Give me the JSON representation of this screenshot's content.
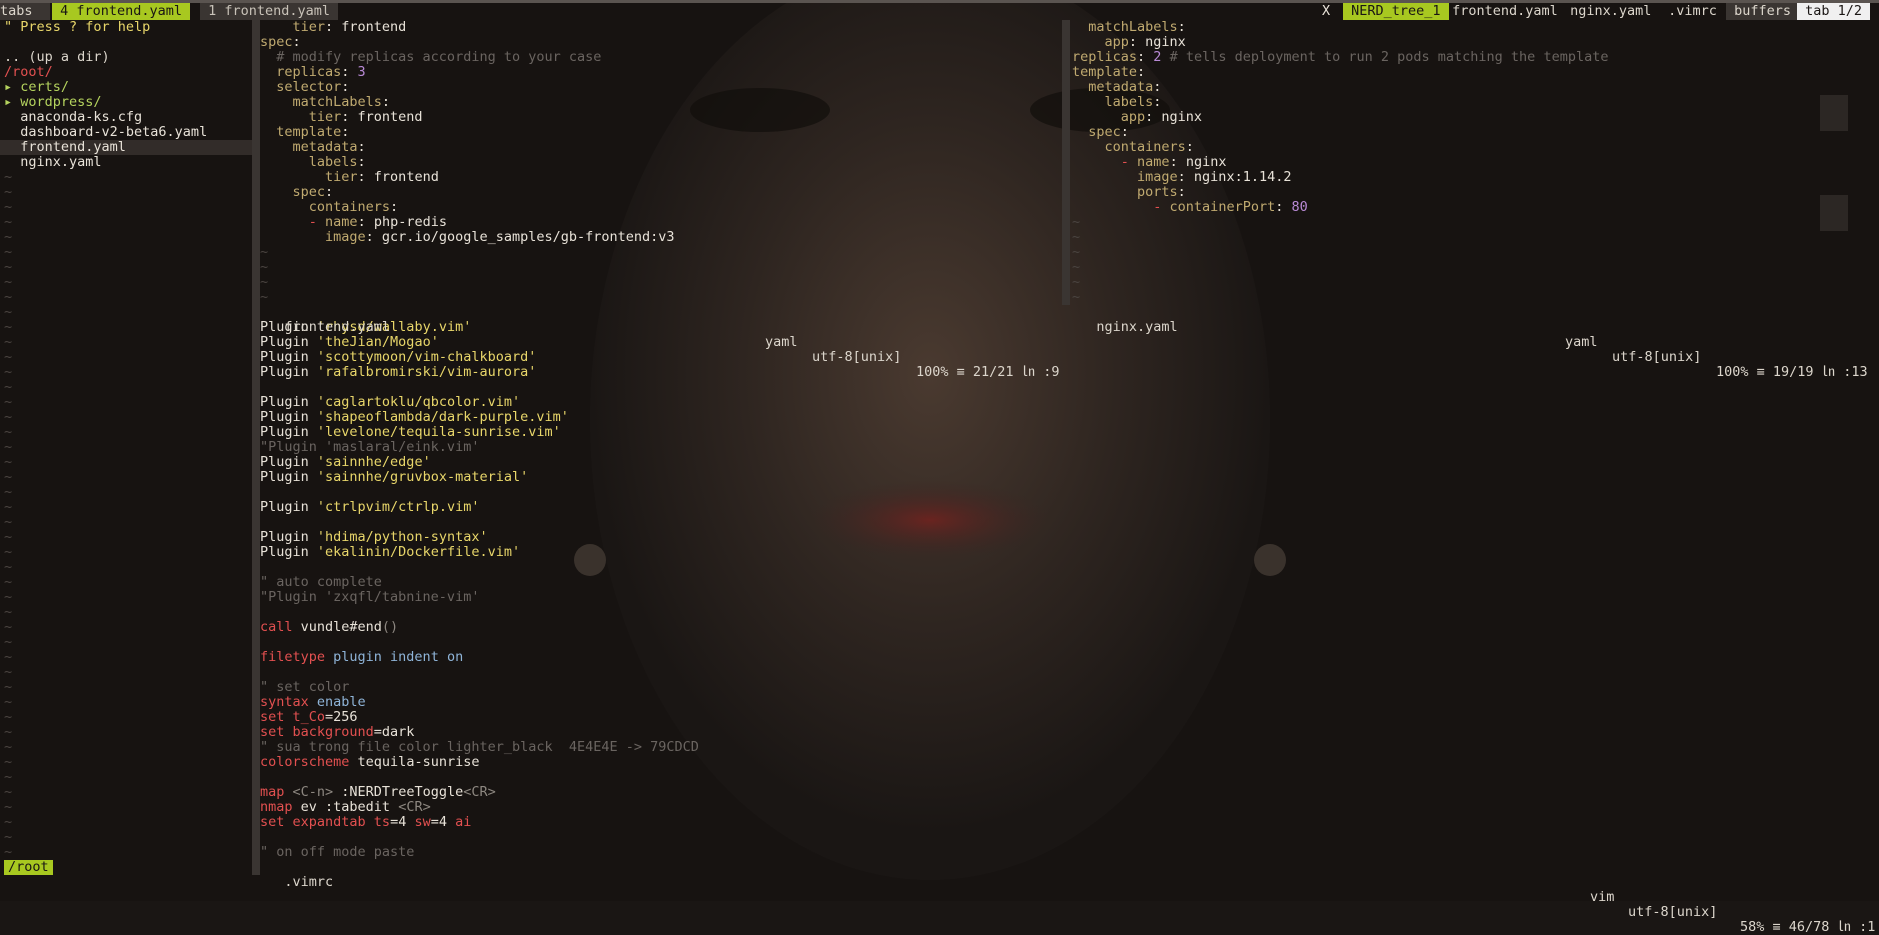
{
  "tabline": {
    "left_label": "tabs",
    "tabs": [
      " 4 frontend.yaml ",
      " 1 frontend.yaml "
    ],
    "close": "X",
    "buffers": [
      " NERD_tree_1 ",
      " frontend.yaml ",
      " nginx.yaml ",
      " .vimrc "
    ],
    "buffers_label": " buffers ",
    "tab_indicator": " tab 1/2 "
  },
  "colors": {
    "accent": "#a8c820",
    "bg": "#1a1614"
  },
  "nerdtree": {
    "help": "\" Press ? for help",
    "up_dir": ".. (up a dir)",
    "root": "/root/",
    "entries": [
      "▸ certs/",
      "▸ wordpress/",
      "  anaconda-ks.cfg",
      "  dashboard-v2-beta6.yaml",
      "  frontend.yaml",
      "  nginx.yaml"
    ],
    "status": "/root"
  },
  "frontend": {
    "lines": [
      [
        [
          "k-key",
          "    tier"
        ],
        [
          "",
          ": frontend"
        ]
      ],
      [
        [
          "k-key",
          "spec"
        ],
        [
          "",
          ":"
        ]
      ],
      [
        [
          "k-cmt",
          "  # modify replicas according to your case"
        ]
      ],
      [
        [
          "k-key",
          "  replicas"
        ],
        [
          "",
          ": "
        ],
        [
          "k-num",
          "3"
        ]
      ],
      [
        [
          "k-key",
          "  selector"
        ],
        [
          "",
          ":"
        ]
      ],
      [
        [
          "k-key",
          "    matchLabels"
        ],
        [
          "",
          ":"
        ]
      ],
      [
        [
          "k-key",
          "      tier"
        ],
        [
          "",
          ": frontend"
        ]
      ],
      [
        [
          "k-key",
          "  template"
        ],
        [
          "",
          ":"
        ]
      ],
      [
        [
          "k-key",
          "    metadata"
        ],
        [
          "",
          ":"
        ]
      ],
      [
        [
          "k-key",
          "      labels"
        ],
        [
          "",
          ":"
        ]
      ],
      [
        [
          "k-key",
          "        tier"
        ],
        [
          "",
          ": frontend"
        ]
      ],
      [
        [
          "k-key",
          "    spec"
        ],
        [
          "",
          ":"
        ]
      ],
      [
        [
          "k-key",
          "      containers"
        ],
        [
          "",
          ":"
        ]
      ],
      [
        [
          "",
          "      "
        ],
        [
          "k-red",
          "- "
        ],
        [
          "k-key",
          "name"
        ],
        [
          "",
          ": php-redis"
        ]
      ],
      [
        [
          "k-key",
          "        image"
        ],
        [
          "",
          ": gcr.io/google_samples/gb-frontend:v3"
        ]
      ]
    ],
    "status": {
      "name": " frontend.yaml",
      "ft": "yaml",
      "enc": "utf-8[unix]",
      "pos": "100% ≡ 21/21 ㏑ :9"
    }
  },
  "nginx": {
    "lines": [
      [
        [
          "k-key",
          "  matchLabels"
        ],
        [
          "",
          ":"
        ]
      ],
      [
        [
          "k-key",
          "    app"
        ],
        [
          "",
          ": nginx"
        ]
      ],
      [
        [
          "k-key",
          "replicas"
        ],
        [
          "",
          ": "
        ],
        [
          "k-num",
          "2"
        ],
        [
          "k-cmt",
          " # tells deployment to run 2 pods matching the template"
        ]
      ],
      [
        [
          "k-key",
          "template"
        ],
        [
          "",
          ":"
        ]
      ],
      [
        [
          "k-key",
          "  metadata"
        ],
        [
          "",
          ":"
        ]
      ],
      [
        [
          "k-key",
          "    labels"
        ],
        [
          "",
          ":"
        ]
      ],
      [
        [
          "k-key",
          "      app"
        ],
        [
          "",
          ": nginx"
        ]
      ],
      [
        [
          "k-key",
          "  spec"
        ],
        [
          "",
          ":"
        ]
      ],
      [
        [
          "k-key",
          "    containers"
        ],
        [
          "",
          ":"
        ]
      ],
      [
        [
          "",
          "      "
        ],
        [
          "k-red",
          "- "
        ],
        [
          "k-key",
          "name"
        ],
        [
          "",
          ": nginx"
        ]
      ],
      [
        [
          "k-key",
          "        image"
        ],
        [
          "",
          ": nginx:1.14.2"
        ]
      ],
      [
        [
          "k-key",
          "        ports"
        ],
        [
          "",
          ":"
        ]
      ],
      [
        [
          "",
          "          "
        ],
        [
          "k-red",
          "- "
        ],
        [
          "k-key",
          "containerPort"
        ],
        [
          "",
          ": "
        ],
        [
          "k-num",
          "80"
        ]
      ]
    ],
    "status": {
      "name": " nginx.yaml",
      "ft": "yaml",
      "enc": "utf-8[unix]",
      "pos": "100% ≡ 19/19 ㏑ :13"
    }
  },
  "vimrc": {
    "lines": [
      [
        [
          "",
          "Plugin "
        ],
        [
          "k-str",
          "'rhysd/wallaby.vim'"
        ]
      ],
      [
        [
          "",
          "Plugin "
        ],
        [
          "k-str",
          "'theJian/Mogao'"
        ]
      ],
      [
        [
          "",
          "Plugin "
        ],
        [
          "k-str",
          "'scottymoon/vim-chalkboard'"
        ]
      ],
      [
        [
          "",
          "Plugin "
        ],
        [
          "k-str",
          "'rafalbromirski/vim-aurora'"
        ]
      ],
      [],
      [
        [
          "",
          "Plugin "
        ],
        [
          "k-str",
          "'caglartoklu/qbcolor.vim'"
        ]
      ],
      [
        [
          "",
          "Plugin "
        ],
        [
          "k-str",
          "'shapeoflambda/dark-purple.vim'"
        ]
      ],
      [
        [
          "",
          "Plugin "
        ],
        [
          "k-str",
          "'levelone/tequila-sunrise.vim'"
        ]
      ],
      [
        [
          "k-cmt",
          "\"Plugin 'maslaral/eink.vim'"
        ]
      ],
      [
        [
          "",
          "Plugin "
        ],
        [
          "k-str",
          "'sainnhe/edge'"
        ]
      ],
      [
        [
          "",
          "Plugin "
        ],
        [
          "k-str",
          "'sainnhe/gruvbox-material'"
        ]
      ],
      [],
      [
        [
          "",
          "Plugin "
        ],
        [
          "k-str",
          "'ctrlpvim/ctrlp.vim'"
        ]
      ],
      [],
      [
        [
          "",
          "Plugin "
        ],
        [
          "k-str",
          "'hdima/python-syntax'"
        ]
      ],
      [
        [
          "",
          "Plugin "
        ],
        [
          "k-str",
          "'ekalinin/Dockerfile.vim'"
        ]
      ],
      [],
      [
        [
          "k-cmt",
          "\" auto complete"
        ]
      ],
      [
        [
          "k-cmt",
          "\"Plugin 'zxqfl/tabnine-vim'"
        ]
      ],
      [],
      [
        [
          "k-red",
          "call "
        ],
        [
          "",
          "vundle#end"
        ],
        [
          "k-grey",
          "()"
        ]
      ],
      [],
      [
        [
          "k-red",
          "filetype "
        ],
        [
          "k-blue",
          "plugin indent on"
        ]
      ],
      [],
      [
        [
          "k-cmt",
          "\" set color"
        ]
      ],
      [
        [
          "k-red",
          "syntax "
        ],
        [
          "k-blue",
          "enable"
        ]
      ],
      [
        [
          "k-red",
          "set "
        ],
        [
          "k-red",
          "t_Co"
        ],
        [
          "",
          "=256"
        ]
      ],
      [
        [
          "k-red",
          "set "
        ],
        [
          "k-red",
          "background"
        ],
        [
          "",
          "=dark"
        ]
      ],
      [
        [
          "k-cmt",
          "\" sua trong file color lighter_black  4E4E4E -> 79CDCD"
        ]
      ],
      [
        [
          "k-red",
          "colorscheme "
        ],
        [
          "",
          "tequila-sunrise"
        ]
      ],
      [],
      [
        [
          "k-red",
          "map "
        ],
        [
          "k-grey",
          "<C-n> "
        ],
        [
          "",
          ":NERDTreeToggle"
        ],
        [
          "k-grey",
          "<CR>"
        ]
      ],
      [
        [
          "k-red",
          "nmap "
        ],
        [
          "",
          "ev :tabedit "
        ],
        [
          "k-grey",
          "<CR>"
        ]
      ],
      [
        [
          "k-red",
          "set "
        ],
        [
          "k-red",
          "expandtab "
        ],
        [
          "k-red",
          "ts"
        ],
        [
          "",
          "=4 "
        ],
        [
          "k-red",
          "sw"
        ],
        [
          "",
          "=4 "
        ],
        [
          "k-red",
          "ai"
        ]
      ],
      [],
      [
        [
          "k-cmt",
          "\" on off mode paste"
        ]
      ]
    ],
    "status": {
      "name": " .vimrc",
      "ft": "vim",
      "enc": "utf-8[unix]",
      "pos": "58% ≡ 46/78 ㏑ :1"
    }
  },
  "tilde": "~"
}
